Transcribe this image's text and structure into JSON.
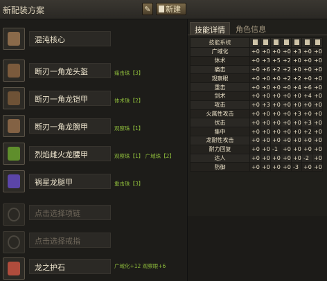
{
  "title": "新配装方案",
  "toolbar": {
    "new_label": "新建"
  },
  "equipment": [
    {
      "name": "混沌核心",
      "jewels": "",
      "icon": "weapon-icon",
      "color": "#8a6a4a"
    },
    {
      "name": "断刃一角龙头盔",
      "jewels": "痛击珠【3】",
      "icon": "helmet-icon",
      "color": "#7b5a3c"
    },
    {
      "name": "断刃一角龙铠甲",
      "jewels": "体术珠【2】",
      "icon": "chest-icon",
      "color": "#6e5236"
    },
    {
      "name": "断刃一角龙腕甲",
      "jewels": "观察珠【1】",
      "icon": "arm-icon",
      "color": "#836244"
    },
    {
      "name": "烈焰雌火龙腰甲",
      "jewels": "观察珠【1】  广域珠【2】",
      "icon": "waist-icon",
      "color": "#5f8e2c"
    },
    {
      "name": "祸星龙腿甲",
      "jewels": "重击珠【3】",
      "icon": "leg-icon",
      "color": "#5b45a8"
    }
  ],
  "accessories": [
    {
      "placeholder": "点击选择项链",
      "icon": "necklace-icon"
    },
    {
      "placeholder": "点击选择戒指",
      "icon": "ring-icon"
    }
  ],
  "charm": {
    "name": "龙之护石",
    "skills": "广域化+12  观察眼+6",
    "icon": "charm-icon",
    "color": "#b04c3c"
  },
  "tabs": {
    "active": "技能详情",
    "inactive": "角色信息"
  },
  "table": {
    "header": "技能系统",
    "column_icons": [
      "weapon-icon",
      "helmet-icon",
      "chest-icon",
      "arm-icon",
      "waist-icon",
      "leg-icon",
      "charm-icon"
    ],
    "rows": [
      {
        "skill": "广域化",
        "values": [
          "+0",
          "+0",
          "+0",
          "+0",
          "+3",
          "+0",
          "+0"
        ]
      },
      {
        "skill": "体术",
        "values": [
          "+0",
          "+3",
          "+5",
          "+2",
          "+0",
          "+0",
          "+0"
        ]
      },
      {
        "skill": "痛击",
        "values": [
          "+0",
          "+6",
          "+2",
          "+2",
          "+0",
          "+0",
          "+0"
        ]
      },
      {
        "skill": "观察眼",
        "values": [
          "+0",
          "+0",
          "+0",
          "+2",
          "+2",
          "+0",
          "+0"
        ]
      },
      {
        "skill": "重击",
        "values": [
          "+0",
          "+0",
          "+0",
          "+0",
          "+4",
          "+6",
          "+0"
        ]
      },
      {
        "skill": "剑术",
        "values": [
          "+0",
          "+0",
          "+0",
          "+0",
          "+0",
          "+4",
          "+0"
        ]
      },
      {
        "skill": "攻击",
        "values": [
          "+0",
          "+3",
          "+0",
          "+0",
          "+0",
          "+0",
          "+0"
        ]
      },
      {
        "skill": "火属性攻击",
        "values": [
          "+0",
          "+0",
          "+0",
          "+0",
          "+3",
          "+0",
          "+0"
        ]
      },
      {
        "skill": "伏击",
        "values": [
          "+0",
          "+0",
          "+0",
          "+0",
          "+0",
          "+3",
          "+0"
        ]
      },
      {
        "skill": "集中",
        "values": [
          "+0",
          "+0",
          "+0",
          "+0",
          "+0",
          "+2",
          "+0"
        ]
      },
      {
        "skill": "龙耐性攻击",
        "values": [
          "+0",
          "+0",
          "+0",
          "+0",
          "+0",
          "+0",
          "+0"
        ]
      },
      {
        "skill": "耐力回复",
        "values": [
          "+0",
          "+0",
          "-1",
          "+0",
          "+0",
          "+0",
          "+0"
        ]
      },
      {
        "skill": "达人",
        "values": [
          "+0",
          "+0",
          "+0",
          "+0",
          "+0",
          "-2",
          "+0"
        ]
      },
      {
        "skill": "防御",
        "values": [
          "+0",
          "+0",
          "+0",
          "+0",
          "-3",
          "+0",
          "+0"
        ]
      }
    ]
  }
}
